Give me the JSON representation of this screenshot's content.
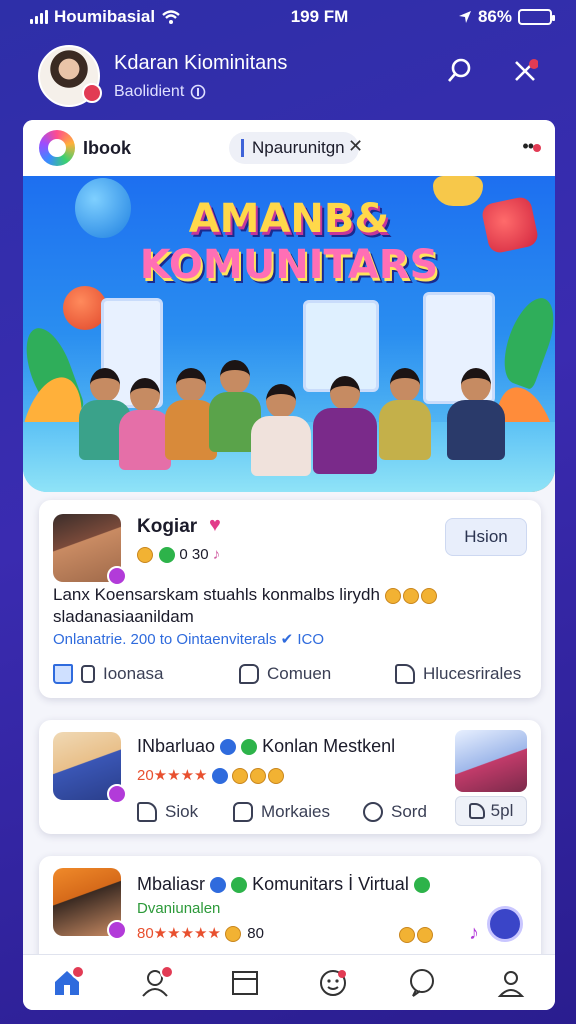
{
  "status_bar": {
    "carrier": "Houmibasial",
    "time": "199 FM",
    "battery": "86%",
    "battery_level": 0.86
  },
  "header": {
    "title": "Kdaran Kiominitans",
    "subtitle": "Baolidient"
  },
  "top_bar": {
    "brand": "Ibook",
    "search_text": "Npaurunitgn"
  },
  "hero": {
    "title_line1": "AMANB&",
    "title_line2": "KOMUNITARS"
  },
  "posts": [
    {
      "author": "Kogiar",
      "meta": "0 30",
      "follow_label": "Hsion",
      "body_line1": "Lanx Koensarskam stuahls konmalbs lirydh",
      "body_line2": "sladanasiaanildam",
      "link_text": "Onlanatrie. 200 to Ointaenviterals ✔ ICO",
      "actions": [
        "Ioonasa",
        "Comuen",
        "Hlucesrirales"
      ]
    },
    {
      "author": "INbarluao",
      "author_tail": "Konlan Mestkenl",
      "stars": "20★★★★",
      "actions": [
        "Siok",
        "Morkaies",
        "Sord"
      ],
      "share_label": "5pl"
    },
    {
      "author": "Mbaliasr",
      "author_tail": "Komunitars İ Virtual",
      "sub_label": "Dvaniunalen",
      "stars": "80★★★★★",
      "count": "80"
    }
  ],
  "nav": [
    "home-icon",
    "people-icon",
    "calendar-icon",
    "emoji-icon",
    "chat-icon",
    "profile-icon"
  ]
}
